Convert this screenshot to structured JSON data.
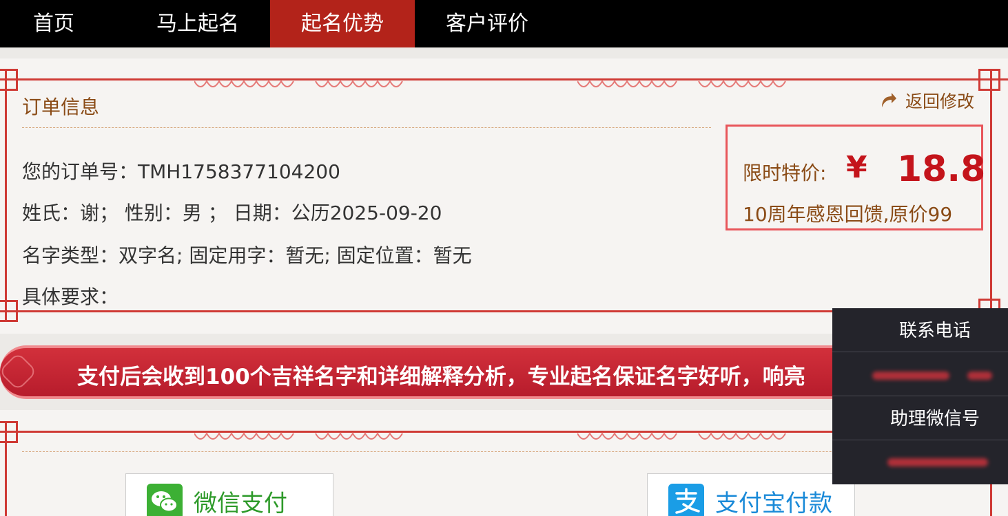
{
  "nav": {
    "items": [
      {
        "label": "首页"
      },
      {
        "label": "马上起名"
      },
      {
        "label": "起名优势"
      },
      {
        "label": "客户评价"
      }
    ],
    "active_index": 2
  },
  "order": {
    "title": "订单信息",
    "back_label": "返回修改",
    "order_no": "您的订单号：TMH1758377104200",
    "basic": "姓氏：谢；  性别：男 ；  日期：公历2025-09-20",
    "name_type": "名字类型：双字名; 固定用字：暂无; 固定位置：暂无",
    "requirement": "具体要求："
  },
  "price": {
    "label": "限时特价:",
    "currency": "¥",
    "value": "18.8",
    "note": "10周年感恩回馈,原价99"
  },
  "banner": {
    "text": "支付后会收到100个吉祥名字和详细解释分析，专业起名保证名字好听，响亮"
  },
  "payment": {
    "wechat_label": "微信支付",
    "alipay_label": "支付宝付款"
  },
  "contact": {
    "phone_label": "联系电话",
    "wechat_label": "助理微信号"
  },
  "colors": {
    "nav_bg": "#000000",
    "nav_active": "#b3231a",
    "frame_red": "#cf3a35",
    "price_red": "#c4141b",
    "brown_text": "#8a4b16",
    "wechat_green": "#3cb034",
    "alipay_blue": "#1a9de6",
    "contact_bg": "#24242b"
  }
}
